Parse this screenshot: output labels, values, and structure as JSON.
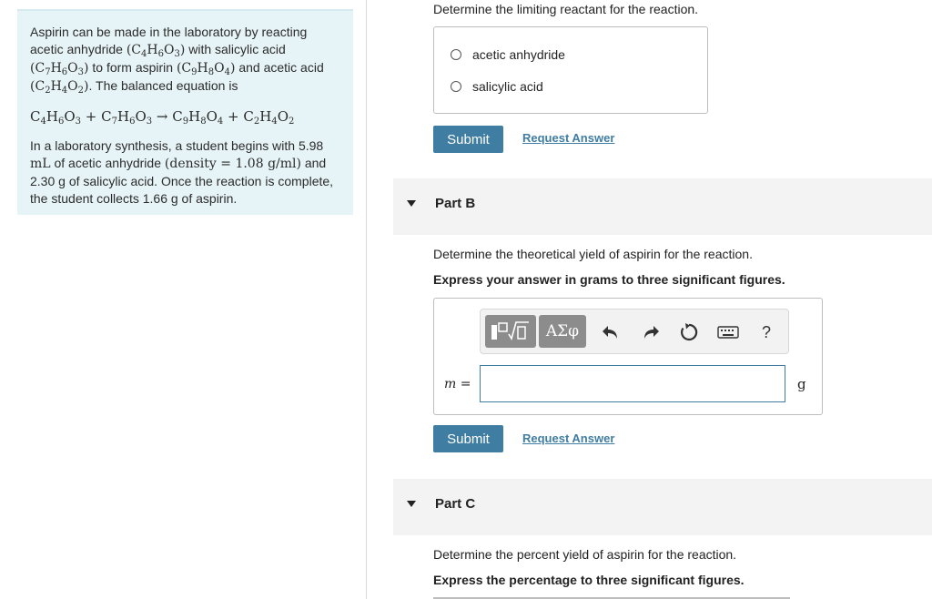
{
  "intro": {
    "para1_a": "Aspirin can be made in the laboratory by reacting acetic anhydride",
    "f_acetic_anhydride": "(C4H6O3)",
    "para1_b": "with salicylic acid",
    "f_salicylic": "(C7H6O3)",
    "para1_c": "to form aspirin",
    "f_aspirin": "(C9H8O4)",
    "para1_d": "and acetic acid",
    "f_acetic_acid": "(C2H4O2)",
    "para1_e": ". The balanced equation is",
    "equation": "C4H6O3 + C7H6O3 → C9H8O4 + C2H4O2",
    "para2_a": "In a laboratory synthesis, a student begins with 5.98",
    "para2_ml": "mL",
    "para2_b": "of acetic anhydride",
    "para2_density": "(density = 1.08 g/ml)",
    "para2_c": "and 2.30 g of salicylic acid. Once the reaction is complete, the student collects 1.66 g of aspirin."
  },
  "partA": {
    "question": "Determine the limiting reactant for the reaction.",
    "options": [
      "acetic anhydride",
      "salicylic acid"
    ],
    "submit": "Submit",
    "request": "Request Answer"
  },
  "partB": {
    "header": "Part B",
    "question": "Determine the theoretical yield of aspirin for the reaction.",
    "instruction": "Express your answer in grams to three significant figures.",
    "var_label": "m =",
    "unit": "g",
    "toolbar": {
      "greek": "ΑΣφ",
      "help": "?"
    },
    "submit": "Submit",
    "request": "Request Answer"
  },
  "partC": {
    "header": "Part C",
    "question": "Determine the percent yield of aspirin for the reaction.",
    "instruction": "Express the percentage to three significant figures."
  }
}
